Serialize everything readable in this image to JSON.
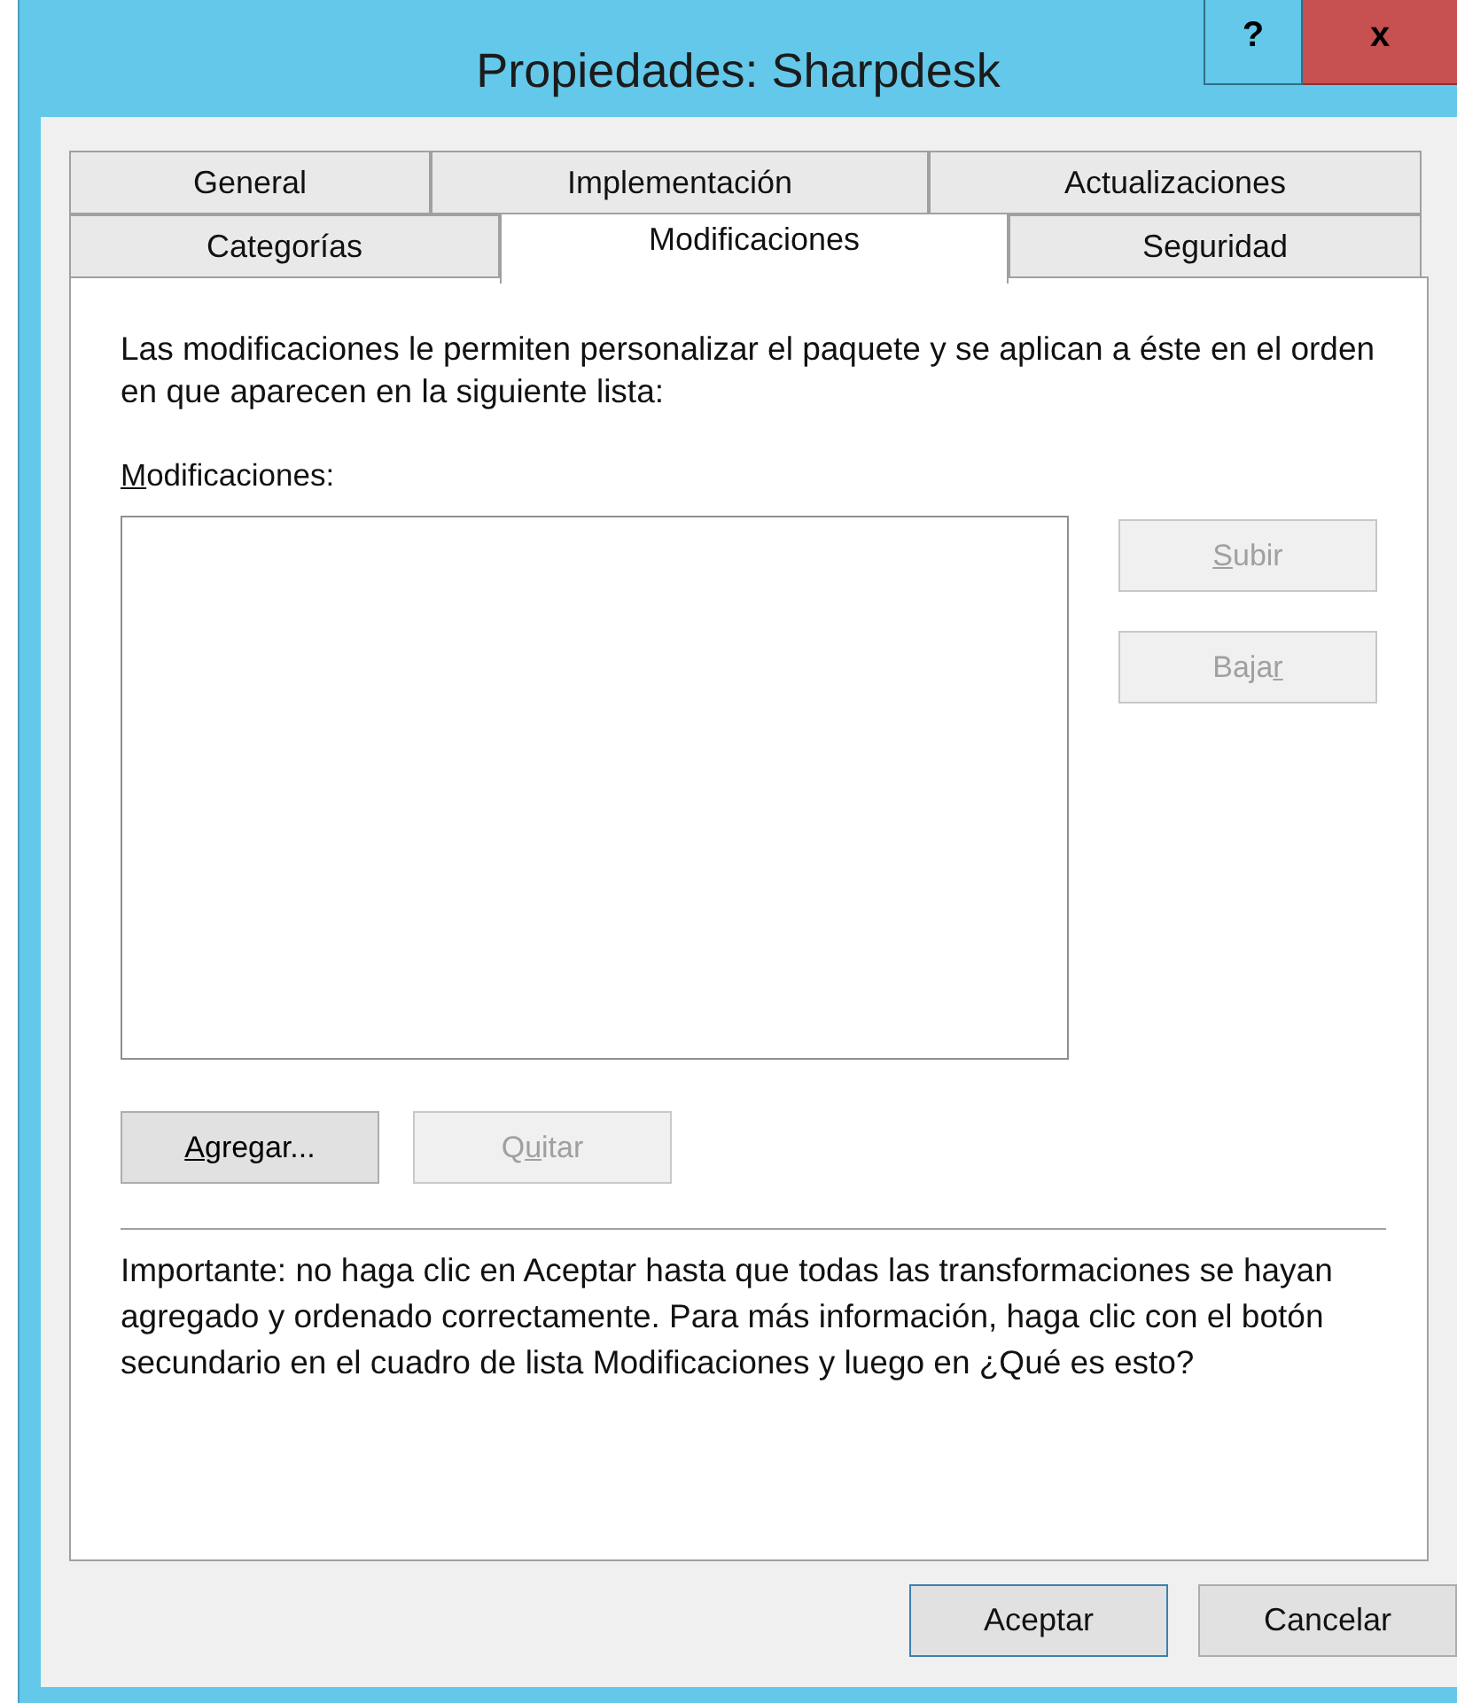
{
  "window": {
    "title": "Propiedades: Sharpdesk",
    "title_buttons": [
      {
        "kind": "help",
        "label": "?"
      },
      {
        "kind": "close",
        "label": "x"
      }
    ]
  },
  "tab_rows": [
    [
      {
        "label": "General",
        "selected": false
      },
      {
        "label": "Implementación",
        "selected": false
      },
      {
        "label": "Actualizaciones",
        "selected": false
      }
    ],
    [
      {
        "label": "Categorías",
        "selected": false
      },
      {
        "label": "Modificaciones",
        "selected": true
      },
      {
        "label": "Seguridad",
        "selected": false
      }
    ]
  ],
  "description": "Las modificaciones le permiten personalizar el paquete y se aplican a éste en el orden en que aparecen en la siguiente lista:",
  "list_label": {
    "key": "M",
    "after": "odificaciones:"
  },
  "side_buttons": [
    {
      "key": "S",
      "after": "ubir",
      "disabled": true
    },
    {
      "before": "Baja",
      "key": "r",
      "disabled": true
    }
  ],
  "list_buttons": [
    {
      "key": "A",
      "after": "gregar...",
      "disabled": false
    },
    {
      "before": "Q",
      "key": "u",
      "after": "itar",
      "disabled": true
    }
  ],
  "note": "Importante: no haga clic en Aceptar hasta que todas las transformaciones se hayan agregado y ordenado correctamente. Para más información, haga clic con el botón secundario en el cuadro de lista Modificaciones y luego en ¿Qué es esto?",
  "dialog_buttons": [
    {
      "label": "Aceptar",
      "default": true
    },
    {
      "label": "Cancelar",
      "default": false
    }
  ]
}
